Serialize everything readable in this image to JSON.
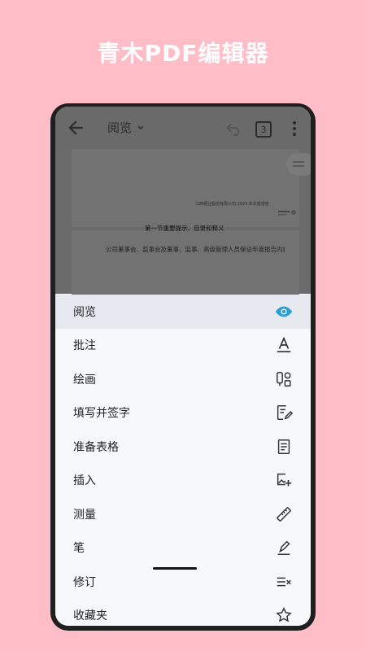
{
  "promo": {
    "title": "青木PDF编辑器"
  },
  "appbar": {
    "mode_label": "阅览",
    "page_count": "3"
  },
  "document": {
    "page_header": "江西铜业股份有限公司 2023 年年度报告",
    "section_title": "第一节重要提示、目录和释义",
    "body_text": "公司董事会、监事会及董事、监事、高级管理人员保证年度报告内容真实"
  },
  "menu": {
    "items": [
      {
        "label": "阅览",
        "icon": "eye-icon",
        "selected": true
      },
      {
        "label": "批注",
        "icon": "text-annotate-icon"
      },
      {
        "label": "绘画",
        "icon": "drawing-tools-icon"
      },
      {
        "label": "填写并签字",
        "icon": "fill-sign-icon"
      },
      {
        "label": "准备表格",
        "icon": "form-icon"
      },
      {
        "label": "插入",
        "icon": "insert-image-icon"
      },
      {
        "label": "测量",
        "icon": "ruler-icon"
      },
      {
        "label": "笔",
        "icon": "pen-icon"
      },
      {
        "label": "修订",
        "icon": "redact-icon"
      },
      {
        "label": "收藏夹",
        "icon": "star-icon"
      }
    ]
  },
  "colors": {
    "accent": "#2a9fd6",
    "background": "#FFBDC8"
  }
}
